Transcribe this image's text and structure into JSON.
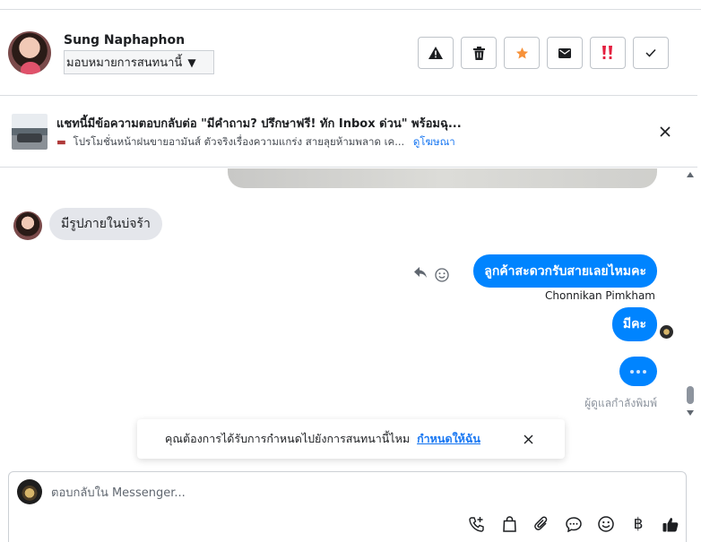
{
  "contact": {
    "name": "Sung Naphaphon",
    "assign_label": "มอบหมายการสนทนานี้"
  },
  "header_actions": [
    {
      "icon": "warning-icon"
    },
    {
      "icon": "trash-icon"
    },
    {
      "icon": "star-icon",
      "color": "#f7923a"
    },
    {
      "icon": "mail-icon"
    },
    {
      "icon": "priority-icon",
      "color": "#e41e3f"
    },
    {
      "icon": "check-icon"
    }
  ],
  "ad_banner": {
    "title": "แชทนี้มีข้อความตอบกลับต่อ \"มีคำถาม? ปรึกษาฟรี! ทัก Inbox ด่วน\" พร้อมฉุ...",
    "subtitle": "โปรโมชั่นหน้าฝนขายอามันส์ ตัวจริงเรื่องความแกร่ง สายลุยห้ามพลาด เค...",
    "link": "ดูโฆษณา"
  },
  "messages": {
    "incoming_1": "มีรูปภายในบ่จร้า",
    "outgoing_1": "ลูกค้าสะดวกรับสายเลยไหมคะ",
    "sender": "Chonnikan Pimkham",
    "outgoing_2": "มีคะ",
    "typing_label": "ผู้ดูแลกำลังพิมพ์"
  },
  "toast": {
    "text": "คุณต้องการได้รับการกำหนดไปยังการสนทนานี้ไหม",
    "link": "กำหนดให้ฉัน"
  },
  "composer": {
    "placeholder": "ตอบกลับใน Messenger...",
    "tools": [
      "call-add-icon",
      "bag-icon",
      "attach-icon",
      "saved-reply-icon",
      "emoji-icon",
      "baht-icon",
      "like-icon"
    ],
    "baht_symbol": "฿"
  },
  "colors": {
    "accent": "#0084ff",
    "link": "#1877f2",
    "star": "#f7923a",
    "priority": "#e41e3f"
  }
}
